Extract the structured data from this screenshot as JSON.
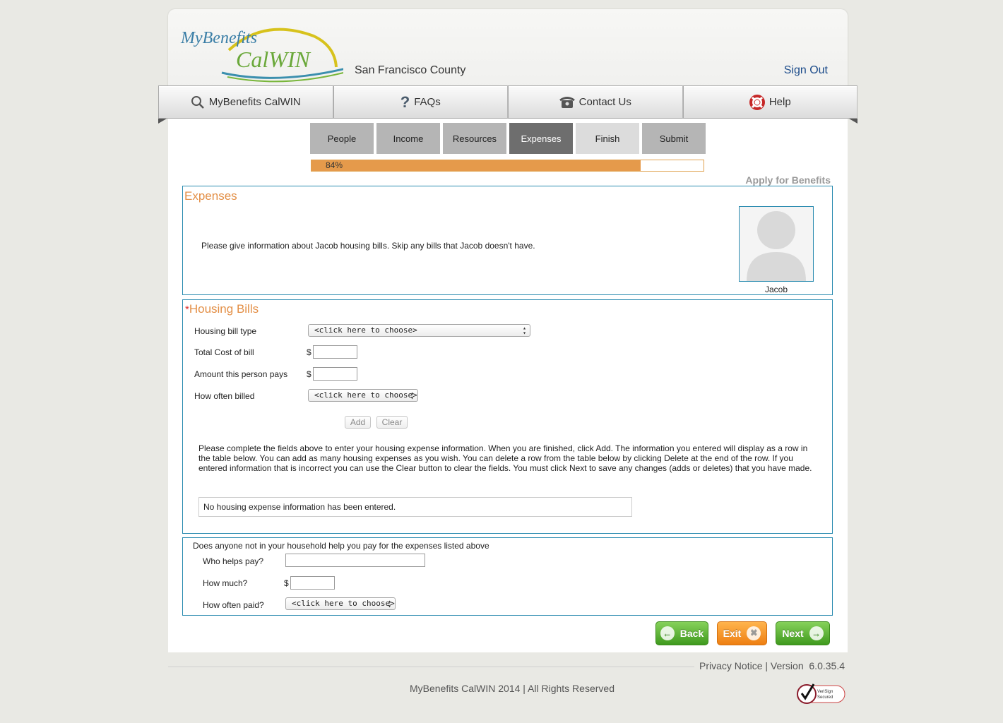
{
  "header": {
    "logo_text_my": "MyBenefits",
    "logo_text_cal": "CalWIN",
    "county": "San Francisco County",
    "sign_out": "Sign Out"
  },
  "nav": {
    "items": [
      {
        "label": "MyBenefits CalWIN",
        "icon": "search-icon"
      },
      {
        "label": "FAQs",
        "icon": "question-icon"
      },
      {
        "label": "Contact Us",
        "icon": "phone-icon"
      },
      {
        "label": "Help",
        "icon": "lifebuoy-icon"
      }
    ]
  },
  "steps": [
    "People",
    "Income",
    "Resources",
    "Expenses",
    "Finish",
    "Submit"
  ],
  "active_step": "Expenses",
  "progress": {
    "value": 84,
    "label": "84%"
  },
  "apply_title": "Apply for Benefits",
  "expenses": {
    "title": "Expenses",
    "instruction": "Please give information about Jacob housing bills. Skip any bills that Jacob doesn't have.",
    "person_name": "Jacob"
  },
  "housing": {
    "required_mark": "*",
    "title": "Housing Bills",
    "bill_type_label": "Housing bill type",
    "bill_type_value": "<click here to choose>",
    "total_cost_label": "Total Cost of bill",
    "amount_label": "Amount this person pays",
    "how_often_label": "How often billed",
    "how_often_value": "<click here to choose>",
    "currency": "$",
    "add_label": "Add",
    "clear_label": "Clear",
    "help_text": "Please complete the fields above to enter your housing expense information. When you are finished, click Add. The information you entered will display as a row in the table below. You can add as many housing expenses as you wish. You can delete a row from the table below by clicking Delete at the end of the row. If you entered information that is incorrect you can use the Clear button to clear the fields. You must click Next to save any changes (adds or deletes) that you have made.",
    "empty_message": "No housing expense information has been entered."
  },
  "helpers": {
    "question": "Does anyone not in your household help you pay for the expenses listed above",
    "who_label": "Who helps pay?",
    "how_much_label": "How much?",
    "how_often_label": "How often paid?",
    "how_often_value": "<click here to choose>",
    "currency": "$"
  },
  "buttons": {
    "back": "Back",
    "exit": "Exit",
    "next": "Next"
  },
  "footer": {
    "privacy": "Privacy Notice",
    "separator": "|",
    "version_label": "Version",
    "version": "6.0.35.4",
    "copyright": "MyBenefits CalWIN 2014 | All Rights Reserved",
    "badge_line1": "VeriSign",
    "badge_line2": "Secured"
  },
  "colors": {
    "accent_orange": "#e38f46",
    "border_blue": "#2a8bb0",
    "link_blue": "#1b4b8a",
    "green_button": "#4ea52a"
  }
}
